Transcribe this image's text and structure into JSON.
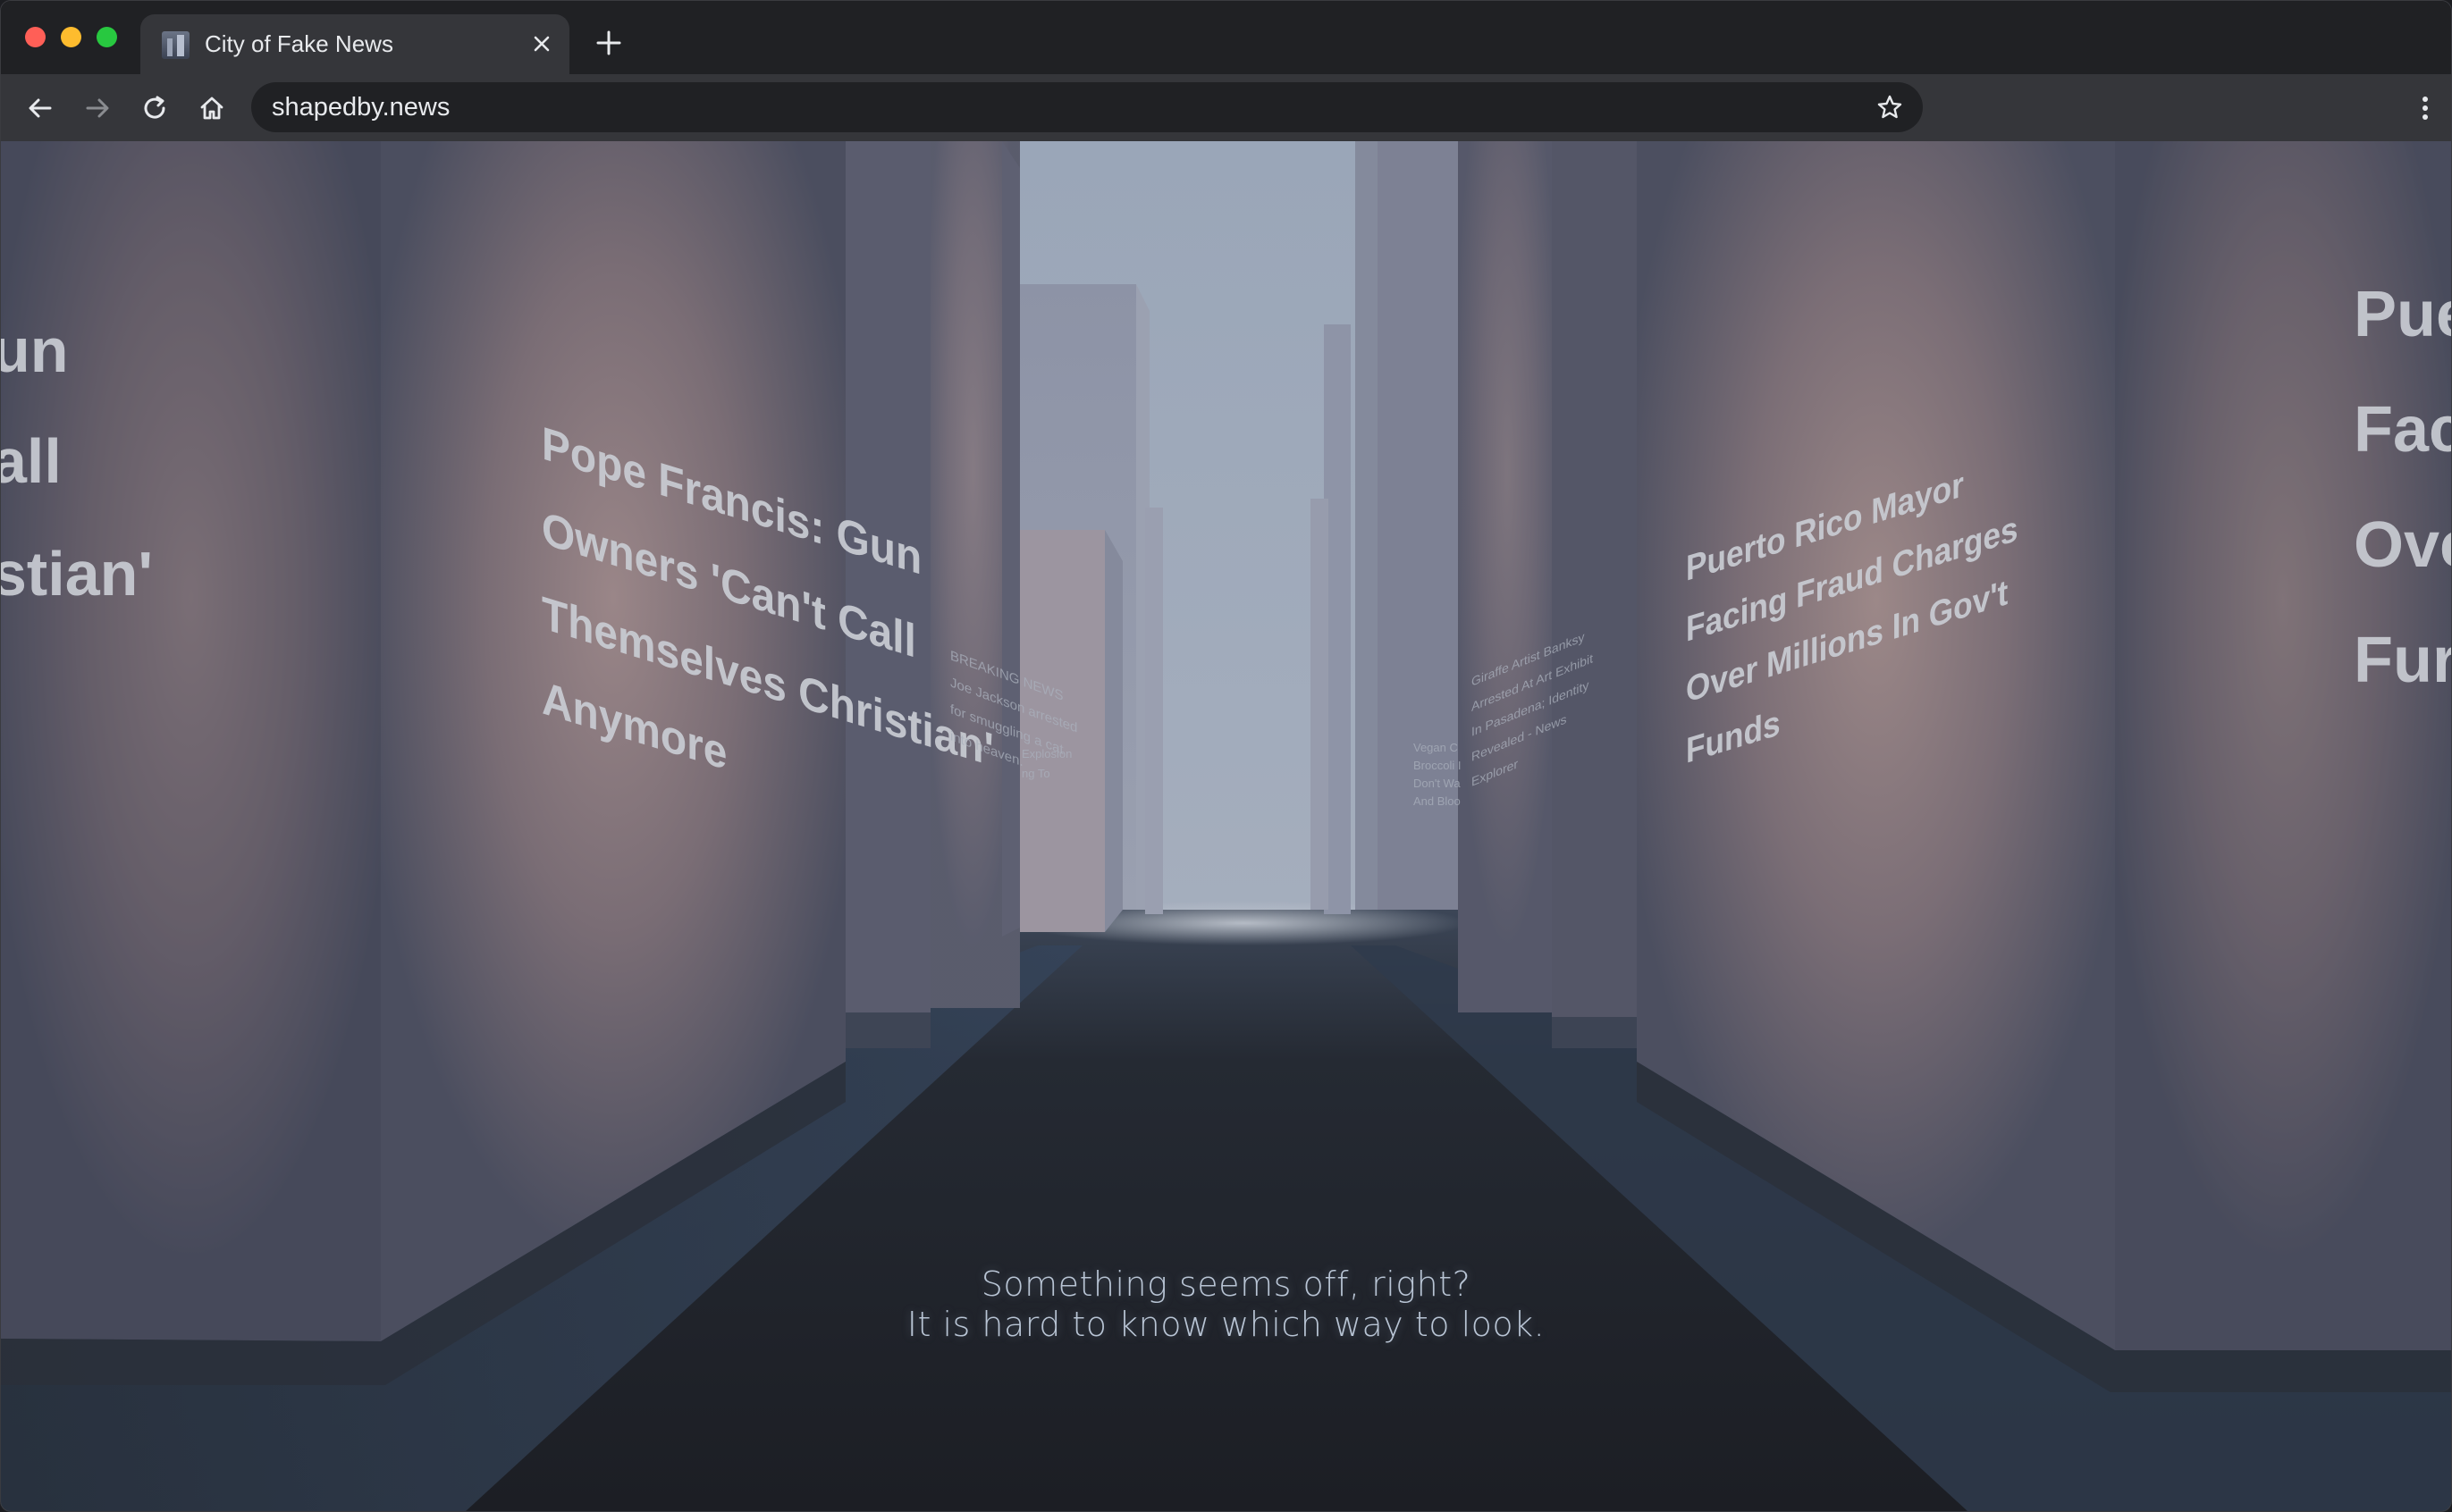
{
  "browser": {
    "tab_title": "City of Fake News",
    "url": "shapedby.news"
  },
  "scene": {
    "left_partial_lines": [
      "un",
      "all",
      "stian'"
    ],
    "left_headline": [
      "Pope Francis: Gun",
      "Owners 'Can't Call",
      "Themselves Christian'",
      "Anymore"
    ],
    "right_headline": [
      "Puerto Rico Mayor",
      "Facing Fraud Charges",
      "Over Millions In Gov't",
      "Funds"
    ],
    "right_partial_lines": [
      "Pue",
      "Fac",
      "Ove",
      "Fur"
    ],
    "small_left_lines": [
      "BREAKING NEWS",
      "Joe Jackson arrested",
      "for smuggling a cat",
      "into heaven."
    ],
    "small_left_mid": [
      "Explosion",
      "ng To"
    ],
    "small_right_lines": [
      "Giraffe Artist Banksy",
      "Arrested At Art Exhibit",
      "In Pasadena; Identity",
      "Revealed - News",
      "Explorer"
    ],
    "small_right_mid": [
      "Vegan C",
      "Broccoli I",
      "Don't Wa",
      "And Bloo"
    ]
  },
  "caption": {
    "line1": "Something seems off, right?",
    "line2": "It is hard to know which way to look."
  },
  "colors": {
    "fog": "#9aa6b8",
    "building": "#4a4d5c",
    "road": "#1e2027",
    "sidewalk": "#2e3a48"
  }
}
